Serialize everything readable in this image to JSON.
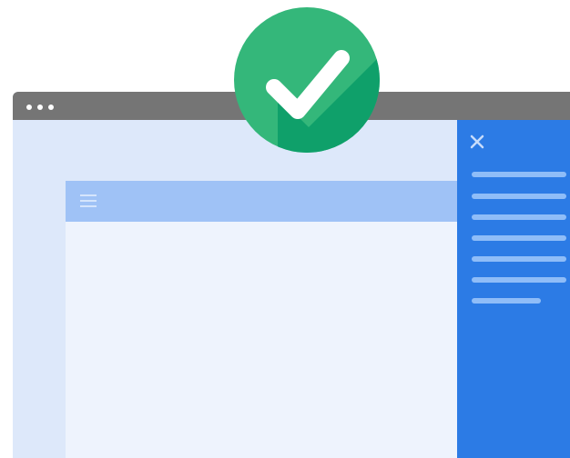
{
  "window": {
    "controls": [
      "window-dot",
      "window-dot",
      "window-dot"
    ]
  },
  "content": {
    "toolbar_icon": "menu-icon"
  },
  "drawer": {
    "close_icon": "close-icon",
    "item_count": 7
  },
  "status": {
    "icon": "check-circle-icon",
    "color": "#34b77a",
    "shadow_color": "#0e9e69"
  },
  "colors": {
    "titlebar": "#757575",
    "window_bg": "#dde8fa",
    "content_bg": "#eef3fd",
    "toolbar": "#9fc2f6",
    "drawer": "#2c7be5",
    "drawer_line": "#8fbdf8"
  }
}
